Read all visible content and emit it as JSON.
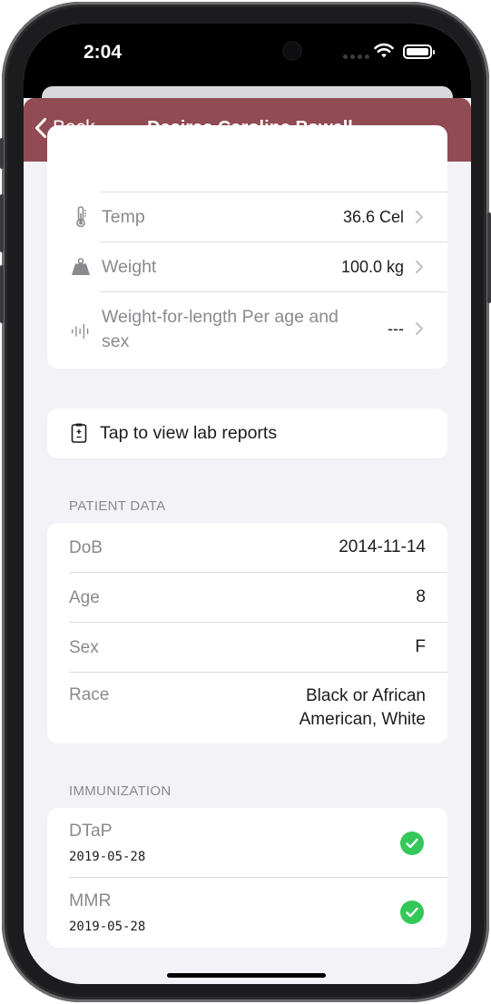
{
  "status_bar": {
    "time": "2:04"
  },
  "nav": {
    "back_label": "Back",
    "title": "Desiree Caroline Powell",
    "bar_color": "#914b52"
  },
  "vitals": [
    {
      "icon": "thermometer-icon",
      "label": "Temp",
      "value": "36.6 Cel"
    },
    {
      "icon": "weight-icon",
      "label": "Weight",
      "value": "100.0 kg"
    },
    {
      "icon": "waveform-icon",
      "label": "Weight-for-length Per age and sex",
      "value": "---"
    }
  ],
  "lab_reports": {
    "icon": "lab-report-icon",
    "label": "Tap to view lab reports"
  },
  "patient_data": {
    "header": "PATIENT DATA",
    "rows": [
      {
        "label": "DoB",
        "value": "2014-11-14"
      },
      {
        "label": "Age",
        "value": "8"
      },
      {
        "label": "Sex",
        "value": "F"
      },
      {
        "label": "Race",
        "value": "Black or African American, White"
      }
    ]
  },
  "immunization": {
    "header": "IMMUNIZATION",
    "items": [
      {
        "name": "DTaP",
        "date": "2019-05-28",
        "status_icon": "checkmark-circle-icon"
      },
      {
        "name": "MMR",
        "date": "2019-05-28",
        "status_icon": "checkmark-circle-icon"
      }
    ]
  },
  "colors": {
    "accent": "#914b52",
    "success": "#34c759",
    "background": "#f2f2f7"
  }
}
